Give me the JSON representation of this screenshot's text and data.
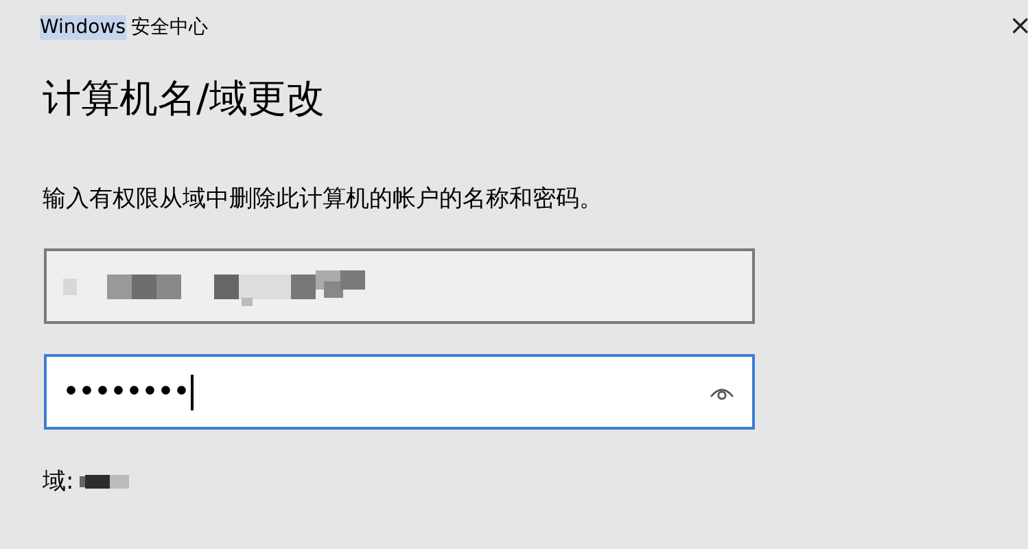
{
  "window": {
    "title_parts": [
      {
        "text": "Windows",
        "highlighted": true
      },
      {
        "text": "安全中心",
        "highlighted": false
      }
    ],
    "close": "×"
  },
  "heading": "计算机名/域更改",
  "instruction": "输入有权限从域中删除此计算机的帐户的名称和密码。",
  "username_field": {
    "disabled": true
  },
  "password_field": {
    "value": "••••••••",
    "focused": true
  },
  "domain": {
    "label": "域:"
  }
}
